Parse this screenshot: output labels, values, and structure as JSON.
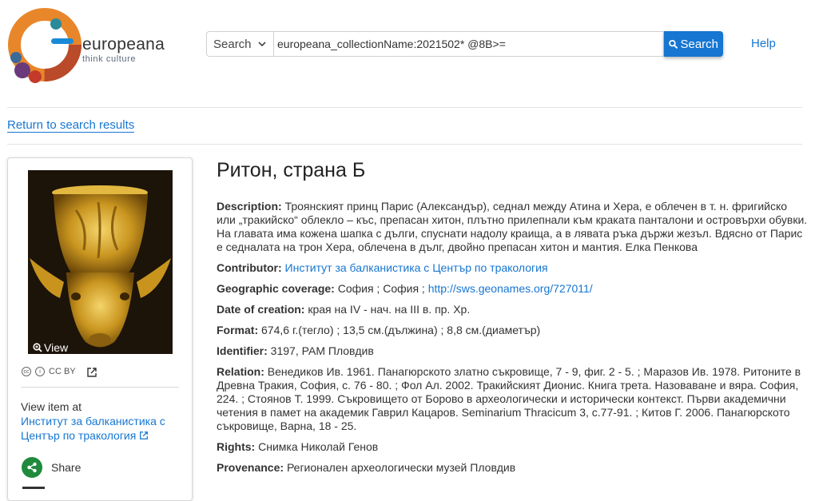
{
  "brand": {
    "name": "europeana",
    "tagline": "think culture"
  },
  "search": {
    "type_label": "Search",
    "query": "europeana_collectionName:2021502* @8B>=",
    "button_label": "Search"
  },
  "nav": {
    "help": "Help",
    "return": "Return to search results"
  },
  "item": {
    "title": "Ритон, страна Б",
    "view_label": "View",
    "license": "CC BY",
    "view_item_at": "View item at",
    "provider": "Институт за балканистика с Център по тракология",
    "share": "Share"
  },
  "fields": [
    {
      "label": "Description:",
      "value": "Троянският принц Парис (Александър), седнал между Атина и Хера, е облечен в т. н. фригийско или „тракийско“ облекло – къс, препасан хитон, плътно прилепнали към краката панталони и островърхи обувки. На главата има кожена шапка с дълги, спуснати надолу краища, а в лявата ръка държи жезъл. Вдясно от Парис е седналата на трон Хера, облечена в дълг, двойно препасан хитон и мантия. Елка Пенкова"
    },
    {
      "label": "Contributor:",
      "link": "Институт за балканистика с Център по тракология"
    },
    {
      "label": "Geographic coverage:",
      "value": "София ; София ; ",
      "link": "http://sws.geonames.org/727011/"
    },
    {
      "label": "Date of creation:",
      "value": "края на IV - нач. на III в. пр. Хр."
    },
    {
      "label": "Format:",
      "value": "674,6 г.(тегло) ; 13,5 см.(дължина) ; 8,8 см.(диаметър)"
    },
    {
      "label": "Identifier:",
      "value": "3197, РАМ Пловдив"
    },
    {
      "label": "Relation:",
      "value": "Венедиков Ив. 1961. Панагюрското златно съкровище, 7 - 9, фиг. 2 - 5. ; Маразов Ив. 1978. Ритоните в Древна Тракия, София, с. 76 - 80. ; Фол Ал. 2002. Тракийският Дионис. Книга трета. Назоваване и вяра. София, 224. ; Стоянов Т. 1999. Съкровището от Борово в археологически и исторически контекст. Първи академични четения в памет на академик Гаврил Кацаров. Seminarium Thracicum 3, с.77-91. ; Китов Г. 2006. Панагюрското съкровище, Варна, 18 - 25."
    },
    {
      "label": "Rights:",
      "value": "Снимка Николай Генов"
    },
    {
      "label": "Provenance:",
      "value": "Регионален археологически музей Пловдив"
    }
  ],
  "colors": {
    "link": "#1676d2",
    "share": "#1f8a3c",
    "accent_logo": "#1a5fa8"
  }
}
